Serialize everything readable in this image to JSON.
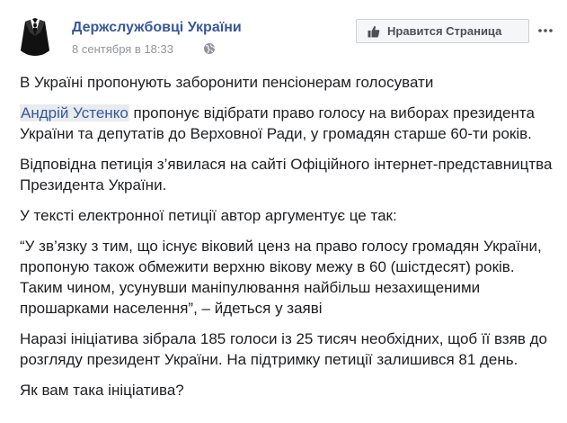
{
  "header": {
    "page_name": "Держслужбовці України",
    "date": "8 сентября в 18:33",
    "like_page_label": "Нравится Страница",
    "more_icon": "ellipsis-icon",
    "privacy_icon": "globe-icon",
    "like_icon": "thumbs-up-icon"
  },
  "post": {
    "title": "В Україні пропонують заборонити пенсіонерам голосувати",
    "p1_mention": "Андрій Устенко",
    "p1_rest": " пропонує відібрати право голосу на виборах президента України та депутатів до Верховної Ради, у громадян старше 60-ти років.",
    "p2": "Відповідна петиція з’явилася на сайті Офіційного інтернет-представництва Президента України.",
    "p3": "У тексті електронної петиції автор аргументує це так:",
    "p4": "“У зв’язку з тим, що існує віковий ценз на право голосу громадян України, пропоную також обмежити верхню вікову межу в 60 (шістдесят) років. Таким чином, усунувши маніпулювання найбільш незахищеними прошарками населення”, – йдеться у заяві",
    "p5": "Наразі ініціатива зібрала 185 голоси із 25 тисяч необхідних, щоб її взяв до розгляду президент України. На підтримку петиції залишився 81 день.",
    "p6": "Як вам така ініціатива?"
  },
  "colors": {
    "link": "#385898",
    "meta": "#90949c",
    "text": "#1c1e21",
    "button_bg": "#f5f6f7"
  }
}
